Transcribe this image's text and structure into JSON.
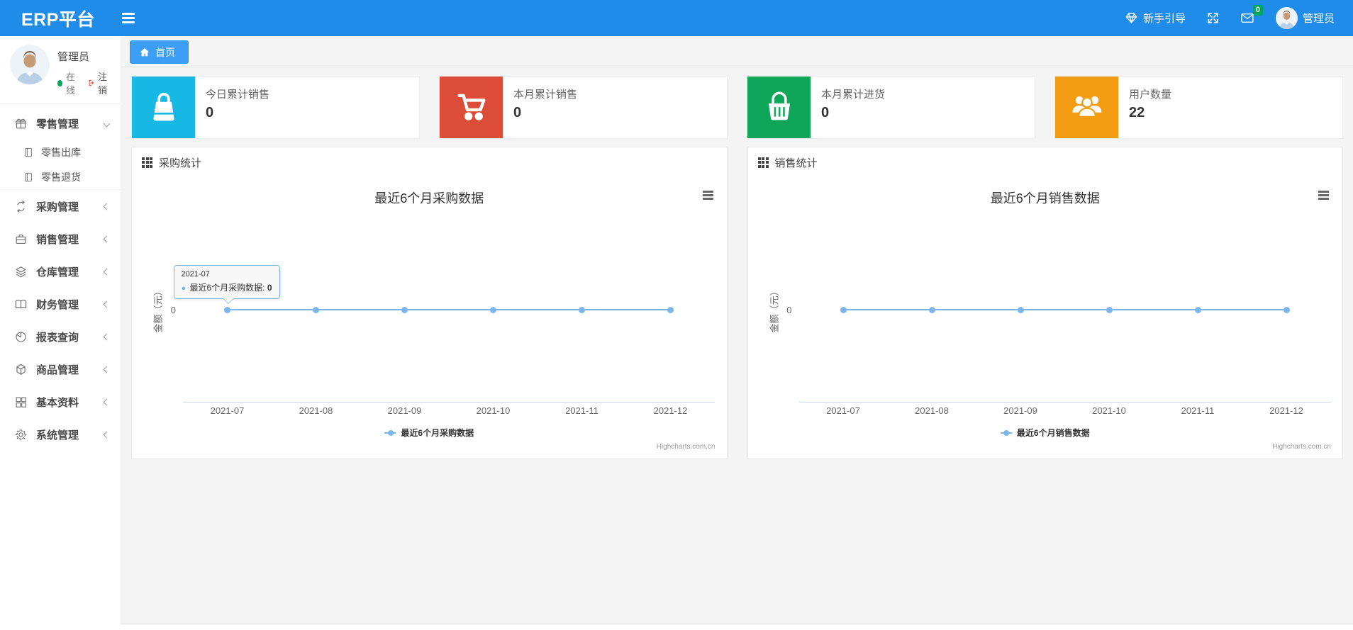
{
  "navbar": {
    "brand": "ERP平台",
    "guide_label": "新手引导",
    "message_badge": "0",
    "username": "管理员",
    "colors": {
      "bar": "#1e8ce8",
      "badge": "#00a65a"
    }
  },
  "sidebar": {
    "user": {
      "name": "管理员",
      "status": "在线",
      "logout": "注销"
    },
    "items": [
      {
        "label": "零售管理",
        "icon": "gift-icon",
        "state": "expanded",
        "children": [
          {
            "label": "零售出库",
            "icon": "journal-icon"
          },
          {
            "label": "零售退货",
            "icon": "journal-icon"
          }
        ]
      },
      {
        "label": "采购管理",
        "icon": "sync-loop-icon",
        "state": "collapsed"
      },
      {
        "label": "销售管理",
        "icon": "briefcase-icon",
        "state": "collapsed"
      },
      {
        "label": "仓库管理",
        "icon": "layers-icon",
        "state": "collapsed"
      },
      {
        "label": "财务管理",
        "icon": "open-book-icon",
        "state": "collapsed"
      },
      {
        "label": "报表查询",
        "icon": "pie-chart-icon",
        "state": "collapsed"
      },
      {
        "label": "商品管理",
        "icon": "package-icon",
        "state": "collapsed"
      },
      {
        "label": "基本资料",
        "icon": "grid-icon",
        "state": "collapsed"
      },
      {
        "label": "系统管理",
        "icon": "gear-icon",
        "state": "collapsed"
      }
    ]
  },
  "tabs": {
    "home": "首页"
  },
  "stat_cards": [
    {
      "label": "今日累计销售",
      "value": "0",
      "color": "#17b8e4",
      "icon": "shopping-bag-icon"
    },
    {
      "label": "本月累计销售",
      "value": "0",
      "color": "#dd4b39",
      "icon": "shopping-cart-icon"
    },
    {
      "label": "本月累计进货",
      "value": "0",
      "color": "#10a65a",
      "icon": "shopping-basket-icon"
    },
    {
      "label": "用户数量",
      "value": "22",
      "color": "#f39c12",
      "icon": "users-icon"
    }
  ],
  "panels": [
    {
      "title": "采购统计"
    },
    {
      "title": "销售统计"
    }
  ],
  "chart_data": [
    {
      "type": "line",
      "title": "最近6个月采购数据",
      "categories": [
        "2021-07",
        "2021-08",
        "2021-09",
        "2021-10",
        "2021-11",
        "2021-12"
      ],
      "series": [
        {
          "name": "最近6个月采购数据",
          "values": [
            0,
            0,
            0,
            0,
            0,
            0
          ]
        }
      ],
      "ylabel": "金额（元）",
      "yticks": [
        "0"
      ],
      "ylim": [
        0,
        0
      ],
      "grid": false,
      "legend_position": "bottom-center",
      "line_color": "#7cb5ec",
      "credits": "Highcharts.com.cn",
      "tooltip": {
        "visible": true,
        "point_index": 0,
        "header": "2021-07",
        "label": "最近6个月采购数据",
        "value": "0"
      }
    },
    {
      "type": "line",
      "title": "最近6个月销售数据",
      "categories": [
        "2021-07",
        "2021-08",
        "2021-09",
        "2021-10",
        "2021-11",
        "2021-12"
      ],
      "series": [
        {
          "name": "最近6个月销售数据",
          "values": [
            0,
            0,
            0,
            0,
            0,
            0
          ]
        }
      ],
      "ylabel": "金额（元）",
      "yticks": [
        "0"
      ],
      "ylim": [
        0,
        0
      ],
      "grid": false,
      "legend_position": "bottom-center",
      "line_color": "#7cb5ec",
      "credits": "Highcharts.com.cn",
      "tooltip": {
        "visible": false
      }
    }
  ]
}
